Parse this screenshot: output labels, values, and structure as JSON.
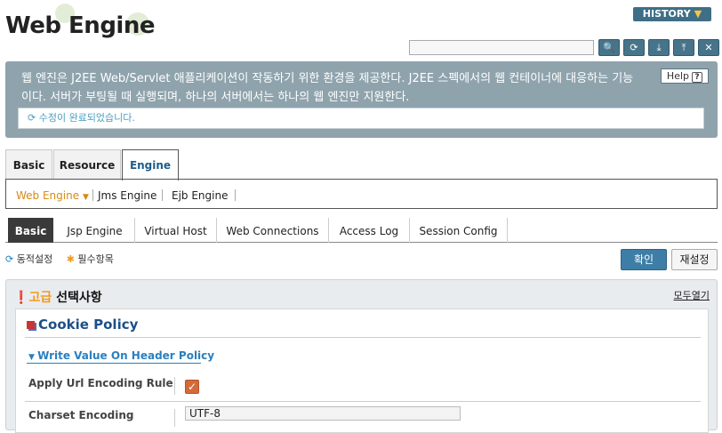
{
  "app": {
    "title": "Web Engine",
    "history_label": "HISTORY",
    "search_placeholder": ""
  },
  "toolbar": {
    "icons": [
      "search-icon",
      "refresh-icon",
      "export-xml-icon",
      "import-xml-icon",
      "close-icon"
    ],
    "search_glyph": "🔍",
    "refresh_glyph": "⟳",
    "export_glyph": "⤓",
    "import_glyph": "⤒",
    "close_glyph": "✕"
  },
  "banner": {
    "text": "웹 엔진은 J2EE Web/Servlet 애플리케이션이 작동하기 위한 환경을 제공한다. J2EE 스펙에서의 웹 컨테이너에 대응하는 기능이다. 서버가 부팅될 때 실행되며, 하나의 서버에서는 하나의 웹 엔진만 지원한다.",
    "help_label": "Help",
    "help_glyph": "?",
    "notice_text": "수정이 완료되었습니다."
  },
  "main_tabs": [
    {
      "label": "Basic"
    },
    {
      "label": "Resource"
    },
    {
      "label": "Engine"
    }
  ],
  "sub_tabs": [
    {
      "label": "Web Engine"
    },
    {
      "label": "Jms Engine"
    },
    {
      "label": "Ejb Engine"
    }
  ],
  "section_tabs": [
    {
      "label": "Basic"
    },
    {
      "label": "Jsp Engine"
    },
    {
      "label": "Virtual Host"
    },
    {
      "label": "Web Connections"
    },
    {
      "label": "Access Log"
    },
    {
      "label": "Session Config"
    }
  ],
  "legend": {
    "dynamic": "동적설정",
    "required": "필수항목"
  },
  "buttons": {
    "confirm": "확인",
    "reset": "재설정"
  },
  "advanced": {
    "prefix": "고급",
    "title": "선택사항",
    "expand_all": "모두열기"
  },
  "cookie_policy": {
    "title": "Cookie Policy",
    "subsection": "Write Value On Header Policy",
    "fields": [
      {
        "label": "Apply Url Encoding Rule",
        "checked": true
      },
      {
        "label": "Charset Encoding",
        "value": "UTF-8"
      }
    ]
  },
  "colors": {
    "accent": "#3e7ea6",
    "active_subtab": "#d88a14",
    "banner": "#8fa3ad",
    "checkbox": "#d46a3a"
  }
}
